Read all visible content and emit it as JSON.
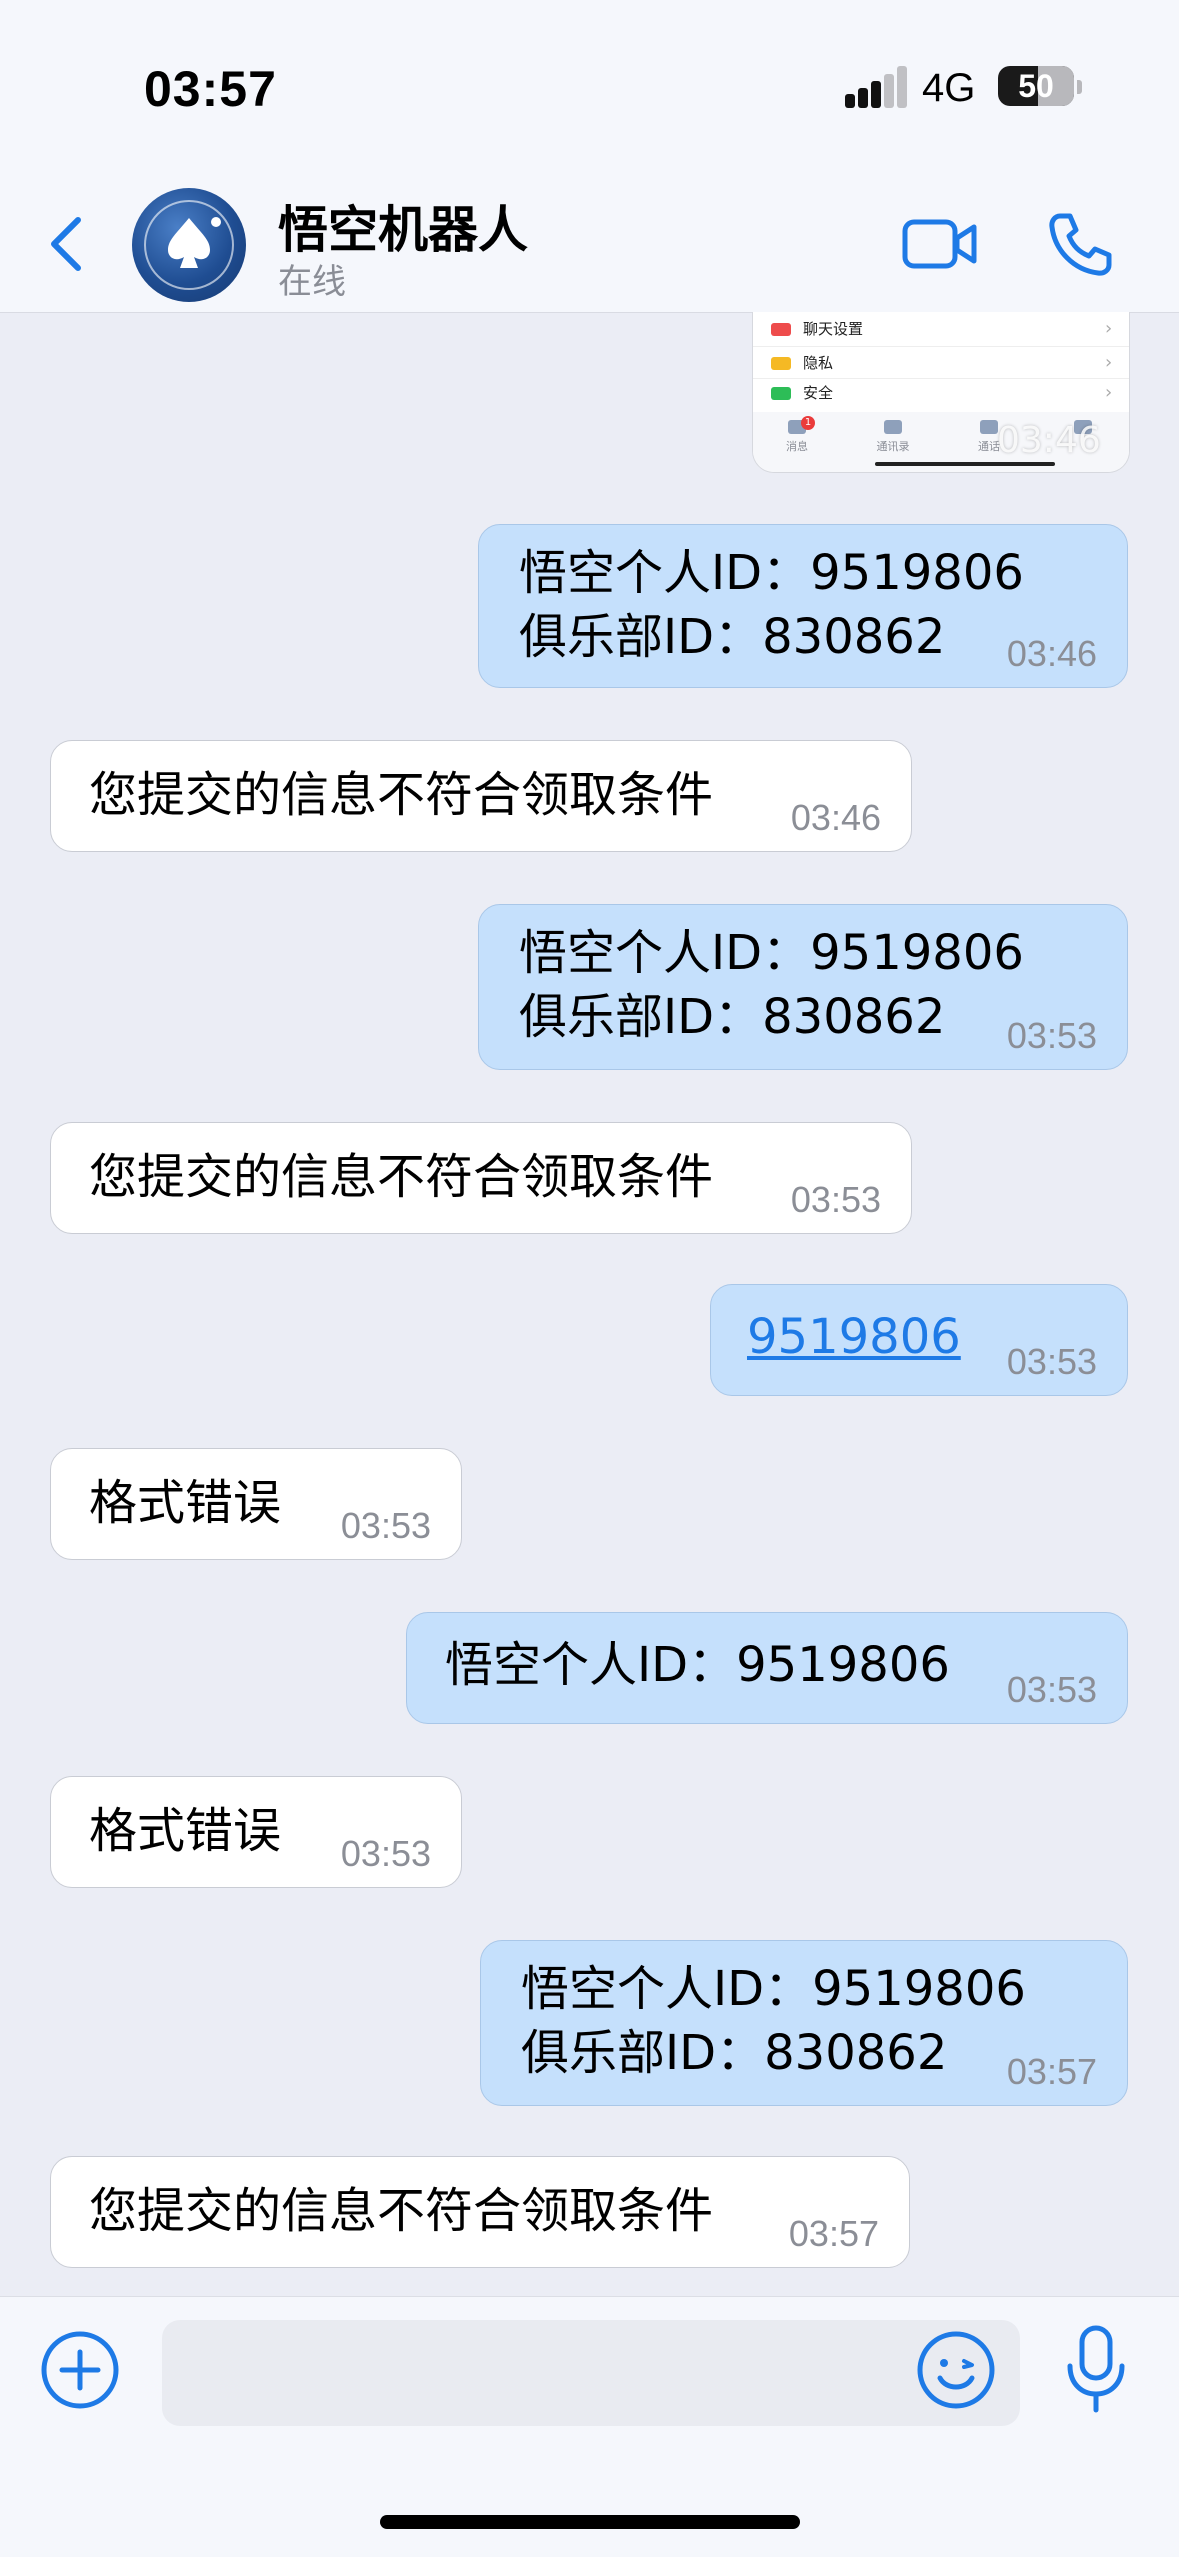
{
  "status_bar": {
    "time": "03:57",
    "network": "4G",
    "battery": "50"
  },
  "header": {
    "title": "悟空机器人",
    "status": "在线"
  },
  "shared_image": {
    "rows": [
      "聊天设置",
      "隐私",
      "安全"
    ],
    "tabs": [
      "消息",
      "通讯录",
      "通话",
      ""
    ],
    "badge": "1",
    "time": "03:46"
  },
  "messages": [
    {
      "dir": "out",
      "text": "悟空个人ID：9519806\n俱乐部ID：830862",
      "time": "03:46"
    },
    {
      "dir": "in",
      "text": "您提交的信息不符合领取条件",
      "time": "03:46"
    },
    {
      "dir": "out",
      "text": "悟空个人ID：9519806\n俱乐部ID：830862",
      "time": "03:53"
    },
    {
      "dir": "in",
      "text": "您提交的信息不符合领取条件",
      "time": "03:53"
    },
    {
      "dir": "out",
      "text": "9519806",
      "time": "03:53"
    },
    {
      "dir": "in",
      "text": "格式错误",
      "time": "03:53"
    },
    {
      "dir": "out",
      "text": "悟空个人ID：9519806",
      "time": "03:53"
    },
    {
      "dir": "in",
      "text": "格式错误",
      "time": "03:53"
    },
    {
      "dir": "out",
      "text": "悟空个人ID：9519806\n俱乐部ID：830862",
      "time": "03:57"
    },
    {
      "dir": "in",
      "text": "您提交的信息不符合领取条件",
      "time": "03:57"
    }
  ],
  "composer": {
    "placeholder": ""
  },
  "colors": {
    "outgoing_bubble": "#c5e0fc",
    "incoming_bubble": "#ffffff",
    "accent": "#1e7ae6",
    "background": "#ebedf5"
  },
  "icons": [
    "back-icon",
    "video-call-icon",
    "phone-call-icon",
    "plus-icon",
    "emoji-icon",
    "microphone-icon"
  ]
}
